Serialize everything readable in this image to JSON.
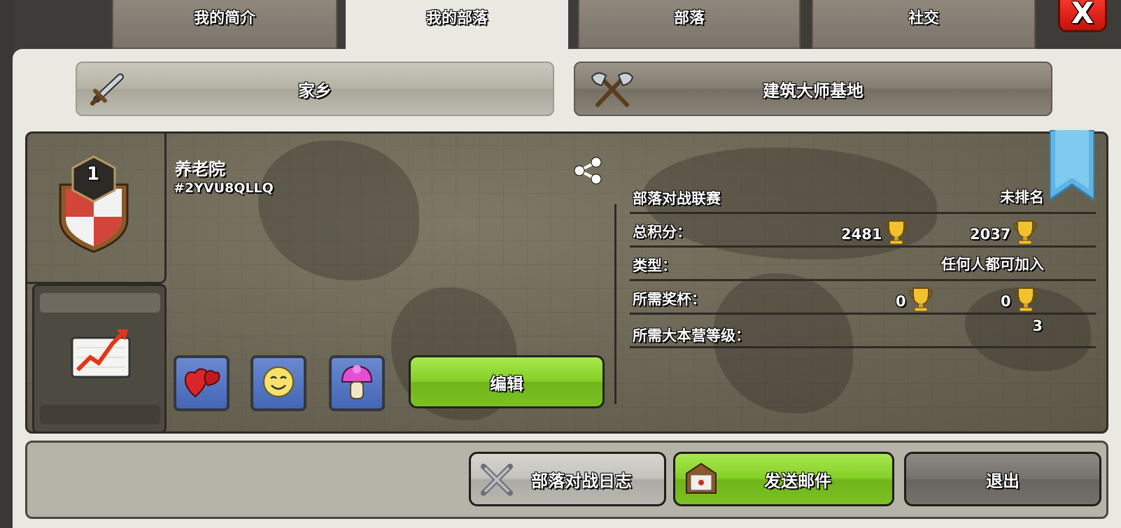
{
  "tabs": [
    {
      "label": "我的简介",
      "active": false
    },
    {
      "label": "我的部落",
      "active": true
    },
    {
      "label": "部落",
      "active": false
    },
    {
      "label": "社交",
      "active": false
    }
  ],
  "close": {
    "label": "X",
    "icon": "close-icon"
  },
  "villages": {
    "home": {
      "label": "家乡",
      "icon": "sword-icon"
    },
    "builder": {
      "label": "建筑大师基地",
      "icon": "crossed-axes-icon"
    }
  },
  "clan": {
    "name": "养老院",
    "tag": "#2YVU8QLLQ",
    "level": "1",
    "badge_icon": "clan-shield-badge-icon",
    "share_icon": "share-icon"
  },
  "stats": {
    "war_league": {
      "label": "部落对战联赛",
      "value": "未排名"
    },
    "total_points": {
      "label": "总积分：",
      "home": "2481",
      "builder": "2037"
    },
    "type": {
      "label": "类型：",
      "value": "任何人都可加入"
    },
    "required_trophies": {
      "label": "所需奖杯：",
      "home": "0",
      "builder": "0"
    },
    "required_th": {
      "label": "所需大本营等级：",
      "value": "3"
    }
  },
  "labels": [
    "heart-icon",
    "smile-icon",
    "mushroom-icon"
  ],
  "edit_label": "编辑",
  "bottom": {
    "war_log": "部落对战日志",
    "send_mail": "发送邮件",
    "leave": "退出"
  },
  "colors": {
    "green_button": "#86cf27",
    "close_red": "#e0261c",
    "trophy_gold": "#f2c12e",
    "label_blue": "#5577c4"
  }
}
